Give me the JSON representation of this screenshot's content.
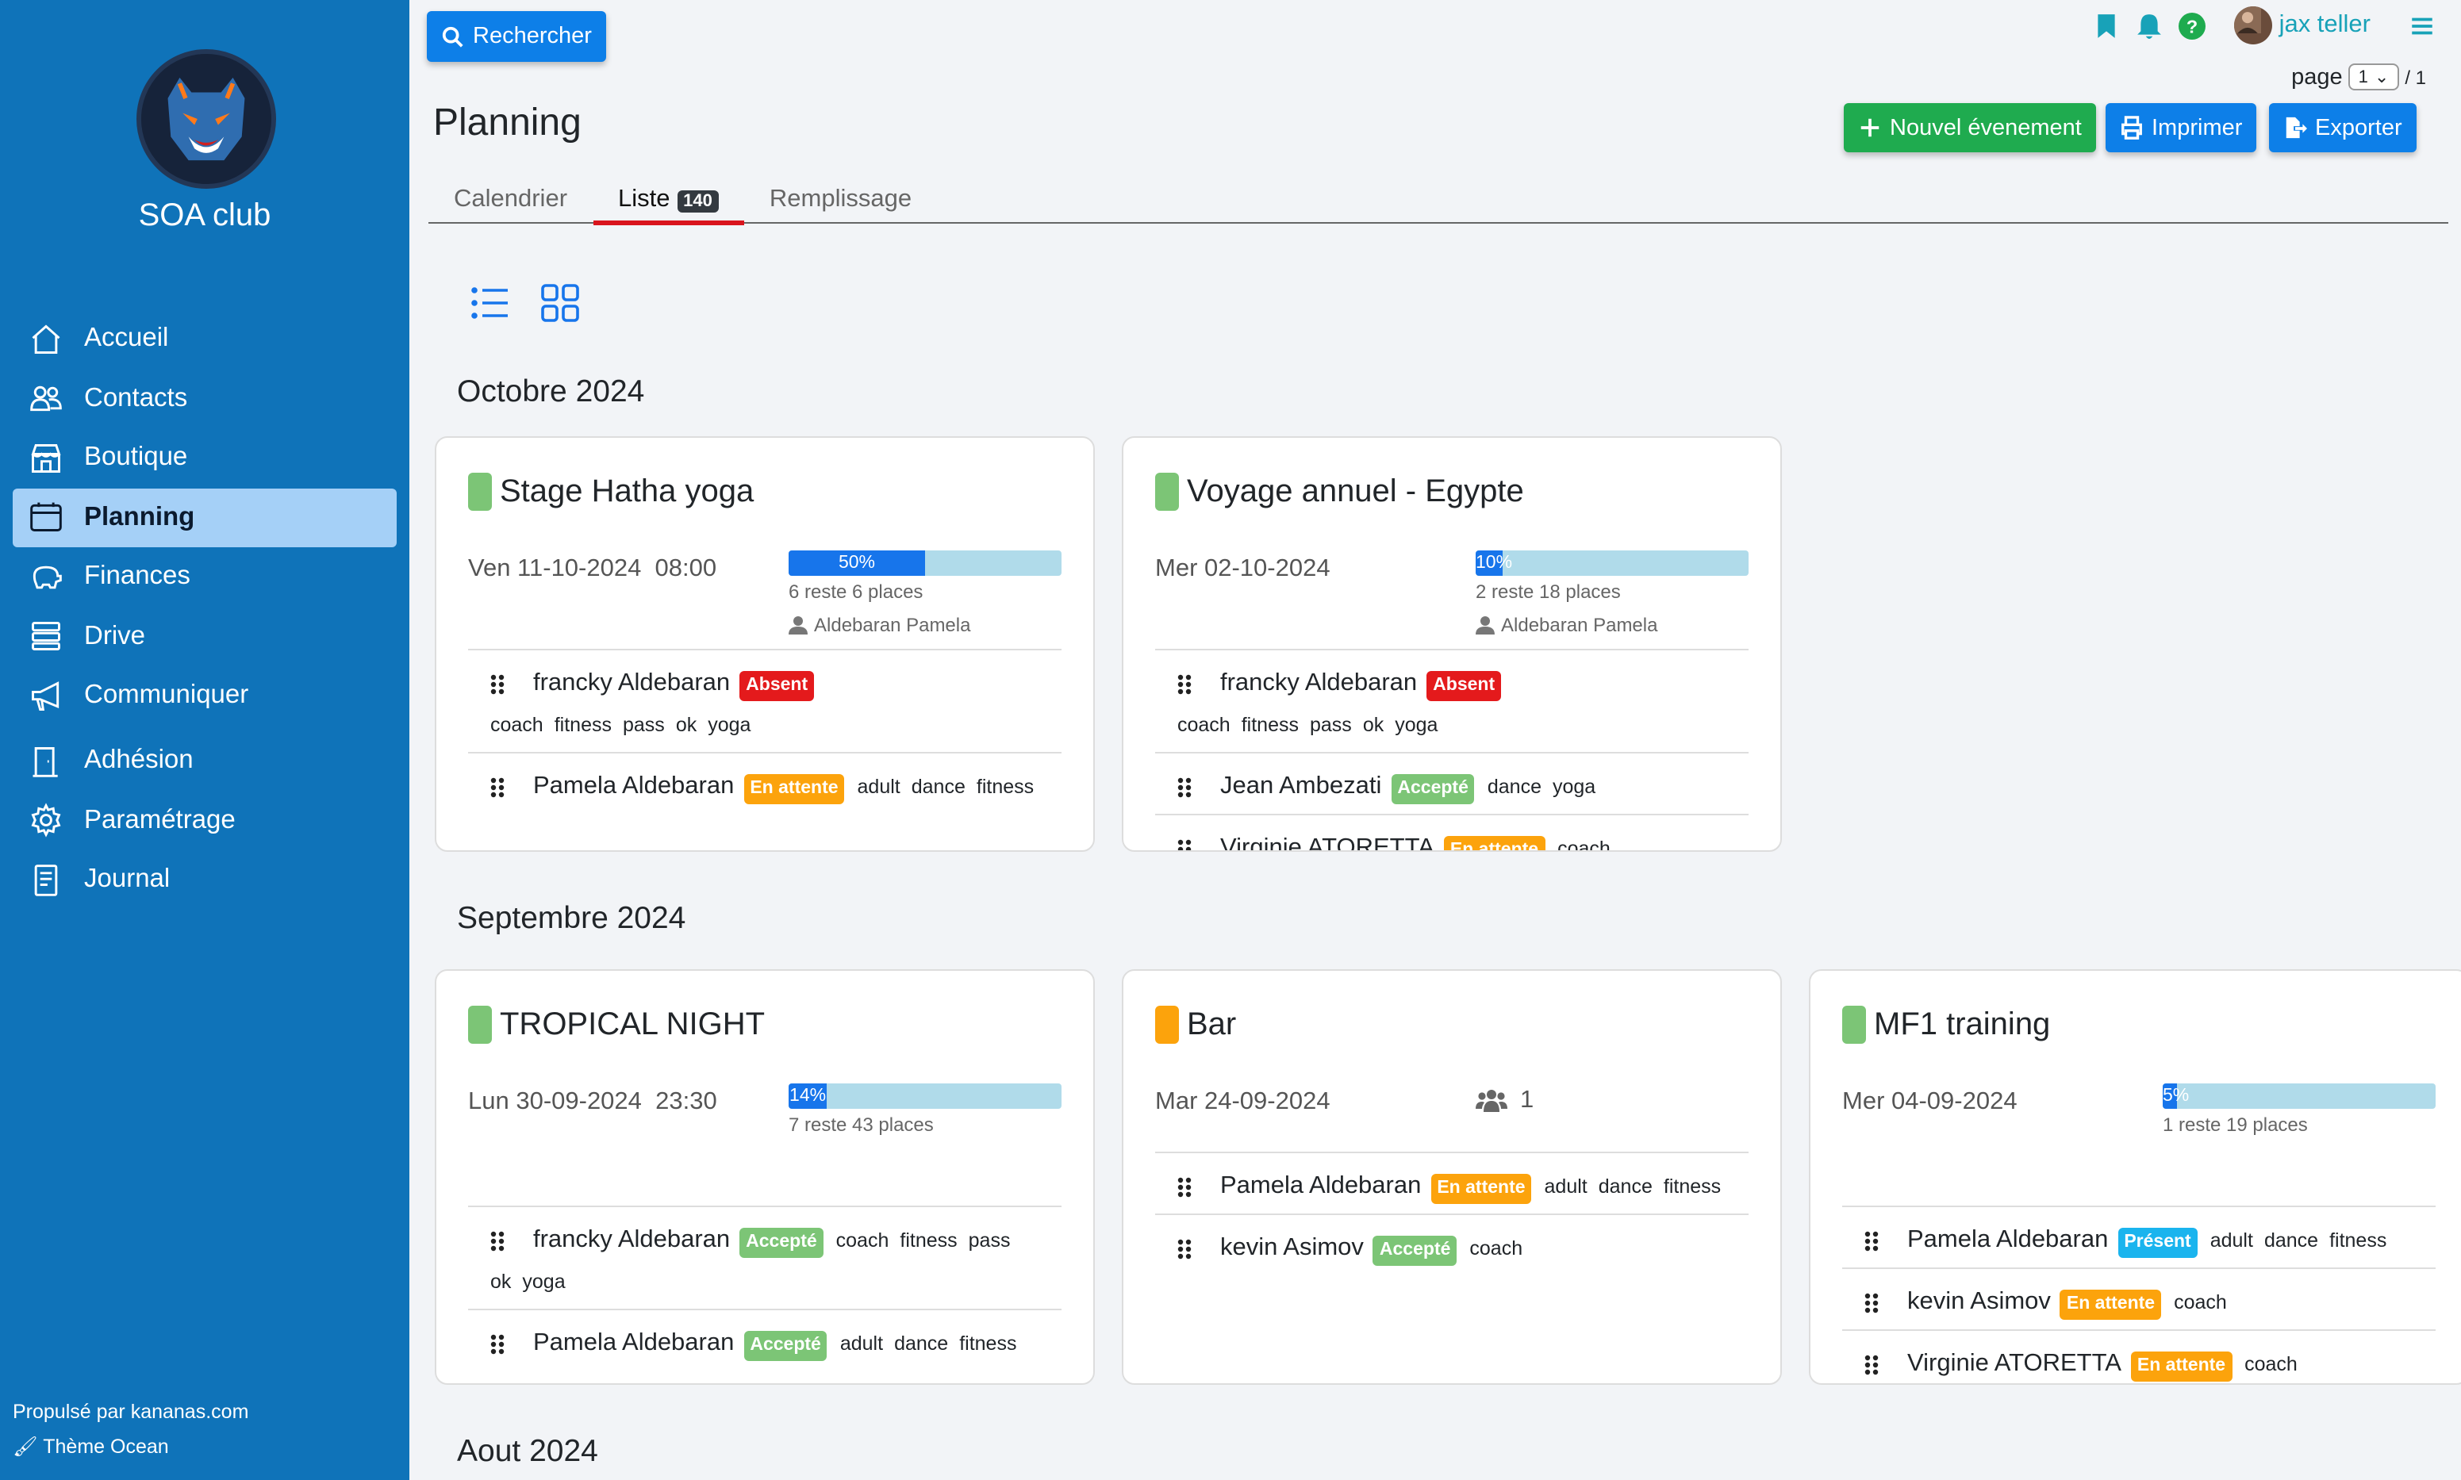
{
  "sidebar": {
    "club_name": "SOA club",
    "items": [
      {
        "label": "Accueil",
        "icon": "home-icon"
      },
      {
        "label": "Contacts",
        "icon": "users-icon"
      },
      {
        "label": "Boutique",
        "icon": "shop-icon"
      },
      {
        "label": "Planning",
        "icon": "calendar-icon"
      },
      {
        "label": "Finances",
        "icon": "piggy-bank-icon"
      },
      {
        "label": "Drive",
        "icon": "server-icon"
      },
      {
        "label": "Communiquer",
        "icon": "megaphone-icon"
      },
      {
        "label": "Adhésion",
        "icon": "door-icon"
      },
      {
        "label": "Paramétrage",
        "icon": "gear-icon"
      },
      {
        "label": "Journal",
        "icon": "journal-icon"
      }
    ],
    "footer_powered": "Propulsé par kananas.com",
    "footer_theme": "Thème Ocean"
  },
  "header": {
    "search_label": "Rechercher",
    "user_name": "jax teller",
    "page_label": "page",
    "page_value": "1",
    "page_total": "/ 1"
  },
  "page": {
    "title": "Planning",
    "new_event": "Nouvel évenement",
    "print": "Imprimer",
    "export": "Exporter",
    "tabs": [
      "Calendrier",
      "Liste",
      "Remplissage"
    ],
    "list_count": "140"
  },
  "months": [
    "Octobre 2024",
    "Septembre 2024",
    "Aout 2024"
  ],
  "events": [
    {
      "title": "Stage Hatha yoga",
      "date": "Ven 11-10-2024  08:00",
      "fill": 50,
      "fill_label": "50%",
      "places": "6 reste 6 places",
      "owner": "Aldebaran Pamela",
      "color": "#7cc576",
      "participants": [
        {
          "name": "francky Aldebaran",
          "status": "Absent",
          "tags": [
            "coach",
            "fitness",
            "pass",
            "ok",
            "yoga"
          ]
        },
        {
          "name": "Pamela Aldebaran",
          "status": "En attente",
          "tags": [
            "adult",
            "dance",
            "fitness"
          ]
        }
      ]
    },
    {
      "title": "Voyage annuel - Egypte",
      "date": "Mer 02-10-2024",
      "fill": 10,
      "fill_label": "10%",
      "places": "2 reste 18 places",
      "owner": "Aldebaran Pamela",
      "color": "#7cc576",
      "participants": [
        {
          "name": "francky Aldebaran",
          "status": "Absent",
          "tags": [
            "coach",
            "fitness",
            "pass",
            "ok",
            "yoga"
          ]
        },
        {
          "name": "Jean Ambezati",
          "status": "Accepté",
          "tags": [
            "dance",
            "yoga"
          ]
        },
        {
          "name": "Virginie ATORETTA",
          "status": "En attente",
          "tags": [
            "coach"
          ]
        }
      ]
    },
    {
      "title": "TROPICAL NIGHT",
      "date": "Lun 30-09-2024  23:30",
      "fill": 14,
      "fill_label": "14%",
      "places": "7 reste 43 places",
      "color": "#7cc576",
      "participants": [
        {
          "name": "francky Aldebaran",
          "status": "Accepté",
          "tags": [
            "coach",
            "fitness",
            "pass ok",
            "yoga"
          ]
        },
        {
          "name": "Pamela Aldebaran",
          "status": "Accepté",
          "tags": [
            "adult",
            "dance",
            "fitness"
          ]
        }
      ]
    },
    {
      "title": "Bar",
      "date": "Mar 24-09-2024",
      "people_count": "1",
      "color": "#fca30c",
      "participants": [
        {
          "name": "Pamela Aldebaran",
          "status": "En attente",
          "tags": [
            "adult",
            "dance",
            "fitness"
          ]
        },
        {
          "name": "kevin Asimov",
          "status": "Accepté",
          "tags": [
            "coach"
          ]
        }
      ]
    },
    {
      "title": "MF1 training",
      "date": "Mer 04-09-2024",
      "fill": 5,
      "fill_label": "5%",
      "places": "1 reste 19 places",
      "color": "#7cc576",
      "participants": [
        {
          "name": "Pamela Aldebaran",
          "status": "Présent",
          "tags": [
            "adult",
            "dance",
            "fitness"
          ]
        },
        {
          "name": "kevin Asimov",
          "status": "En attente",
          "tags": [
            "coach"
          ]
        },
        {
          "name": "Virginie ATORETTA",
          "status": "En attente",
          "tags": [
            "coach"
          ]
        }
      ]
    }
  ]
}
